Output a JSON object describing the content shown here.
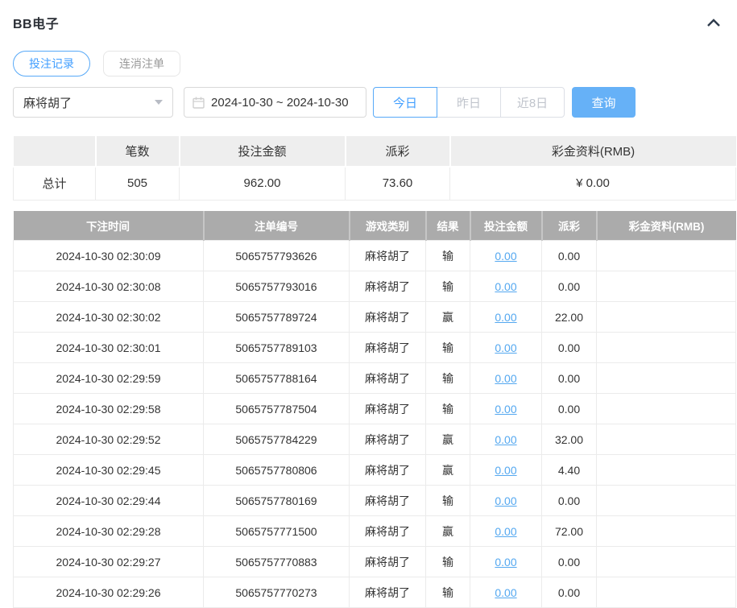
{
  "header": {
    "title": "BB电子",
    "collapse_icon": "chevron-up-icon"
  },
  "tabs": [
    {
      "label": "投注记录",
      "active": true
    },
    {
      "label": "连消注单",
      "active": false
    }
  ],
  "filters": {
    "game_select": {
      "value": "麻将胡了",
      "caret_icon": "chevron-down-icon"
    },
    "date_range": {
      "value": "2024-10-30 ~ 2024-10-30",
      "icon": "calendar-icon"
    },
    "quick_buttons": [
      {
        "label": "今日",
        "active": true
      },
      {
        "label": "昨日",
        "active": false
      },
      {
        "label": "近8日",
        "active": false
      }
    ],
    "search_label": "查询"
  },
  "summary_table": {
    "headers": [
      "",
      "笔数",
      "投注金额",
      "派彩",
      "彩金资料(RMB)"
    ],
    "total": {
      "label": "总计",
      "count": "505",
      "bet_amount": "962.00",
      "payout": "73.60",
      "bonus": "¥ 0.00"
    }
  },
  "records_table": {
    "headers": [
      "下注时间",
      "注单编号",
      "游戏类别",
      "结果",
      "投注金额",
      "派彩",
      "彩金资料(RMB)"
    ],
    "rows": [
      {
        "time": "2024-10-30 02:30:09",
        "bet_no": "5065757793626",
        "game": "麻将胡了",
        "result": "输",
        "bet_amount": "0.00",
        "payout": "0.00",
        "bonus": ""
      },
      {
        "time": "2024-10-30 02:30:08",
        "bet_no": "5065757793016",
        "game": "麻将胡了",
        "result": "输",
        "bet_amount": "0.00",
        "payout": "0.00",
        "bonus": ""
      },
      {
        "time": "2024-10-30 02:30:02",
        "bet_no": "5065757789724",
        "game": "麻将胡了",
        "result": "赢",
        "bet_amount": "0.00",
        "payout": "22.00",
        "bonus": ""
      },
      {
        "time": "2024-10-30 02:30:01",
        "bet_no": "5065757789103",
        "game": "麻将胡了",
        "result": "输",
        "bet_amount": "0.00",
        "payout": "0.00",
        "bonus": ""
      },
      {
        "time": "2024-10-30 02:29:59",
        "bet_no": "5065757788164",
        "game": "麻将胡了",
        "result": "输",
        "bet_amount": "0.00",
        "payout": "0.00",
        "bonus": ""
      },
      {
        "time": "2024-10-30 02:29:58",
        "bet_no": "5065757787504",
        "game": "麻将胡了",
        "result": "输",
        "bet_amount": "0.00",
        "payout": "0.00",
        "bonus": ""
      },
      {
        "time": "2024-10-30 02:29:52",
        "bet_no": "5065757784229",
        "game": "麻将胡了",
        "result": "赢",
        "bet_amount": "0.00",
        "payout": "32.00",
        "bonus": ""
      },
      {
        "time": "2024-10-30 02:29:45",
        "bet_no": "5065757780806",
        "game": "麻将胡了",
        "result": "赢",
        "bet_amount": "0.00",
        "payout": "4.40",
        "bonus": ""
      },
      {
        "time": "2024-10-30 02:29:44",
        "bet_no": "5065757780169",
        "game": "麻将胡了",
        "result": "输",
        "bet_amount": "0.00",
        "payout": "0.00",
        "bonus": ""
      },
      {
        "time": "2024-10-30 02:29:28",
        "bet_no": "5065757771500",
        "game": "麻将胡了",
        "result": "赢",
        "bet_amount": "0.00",
        "payout": "72.00",
        "bonus": ""
      },
      {
        "time": "2024-10-30 02:29:27",
        "bet_no": "5065757770883",
        "game": "麻将胡了",
        "result": "输",
        "bet_amount": "0.00",
        "payout": "0.00",
        "bonus": ""
      },
      {
        "time": "2024-10-30 02:29:26",
        "bet_no": "5065757770273",
        "game": "麻将胡了",
        "result": "输",
        "bet_amount": "0.00",
        "payout": "0.00",
        "bonus": ""
      }
    ]
  },
  "colors": {
    "accent_blue": "#409eff",
    "search_button_bg": "#66b1f7",
    "records_header_bg": "#ababab",
    "summary_header_bg": "#eeeeee",
    "amount_link": "#54a8f0"
  }
}
